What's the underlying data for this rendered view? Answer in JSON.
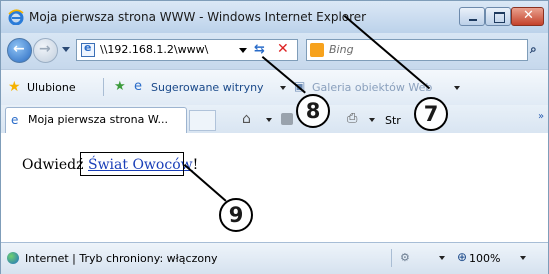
{
  "window": {
    "title": "Moja pierwsza strona WWW - Windows Internet Explorer"
  },
  "address_bar": {
    "url": "\\\\192.168.1.2\\www\\"
  },
  "search_box": {
    "placeholder": "Bing"
  },
  "favorites_bar": {
    "favorites_label": "Ulubione",
    "suggested_label": "Sugerowane witryny",
    "gallery_label": "Galeria obiektów Web"
  },
  "tabs": [
    {
      "label": "Moja pierwsza strona W..."
    }
  ],
  "command_bar": {
    "page_label": "Str"
  },
  "content": {
    "prefix": "Odwiedź ",
    "link_text": "Świat Owoców",
    "suffix": "!"
  },
  "status_bar": {
    "zone_text": "Internet | Tryb chroniony: włączony",
    "zoom": "100%"
  },
  "callouts": [
    "7",
    "8",
    "9"
  ],
  "colors": {
    "link": "#1a3fb8",
    "close_button": "#c4422b"
  }
}
